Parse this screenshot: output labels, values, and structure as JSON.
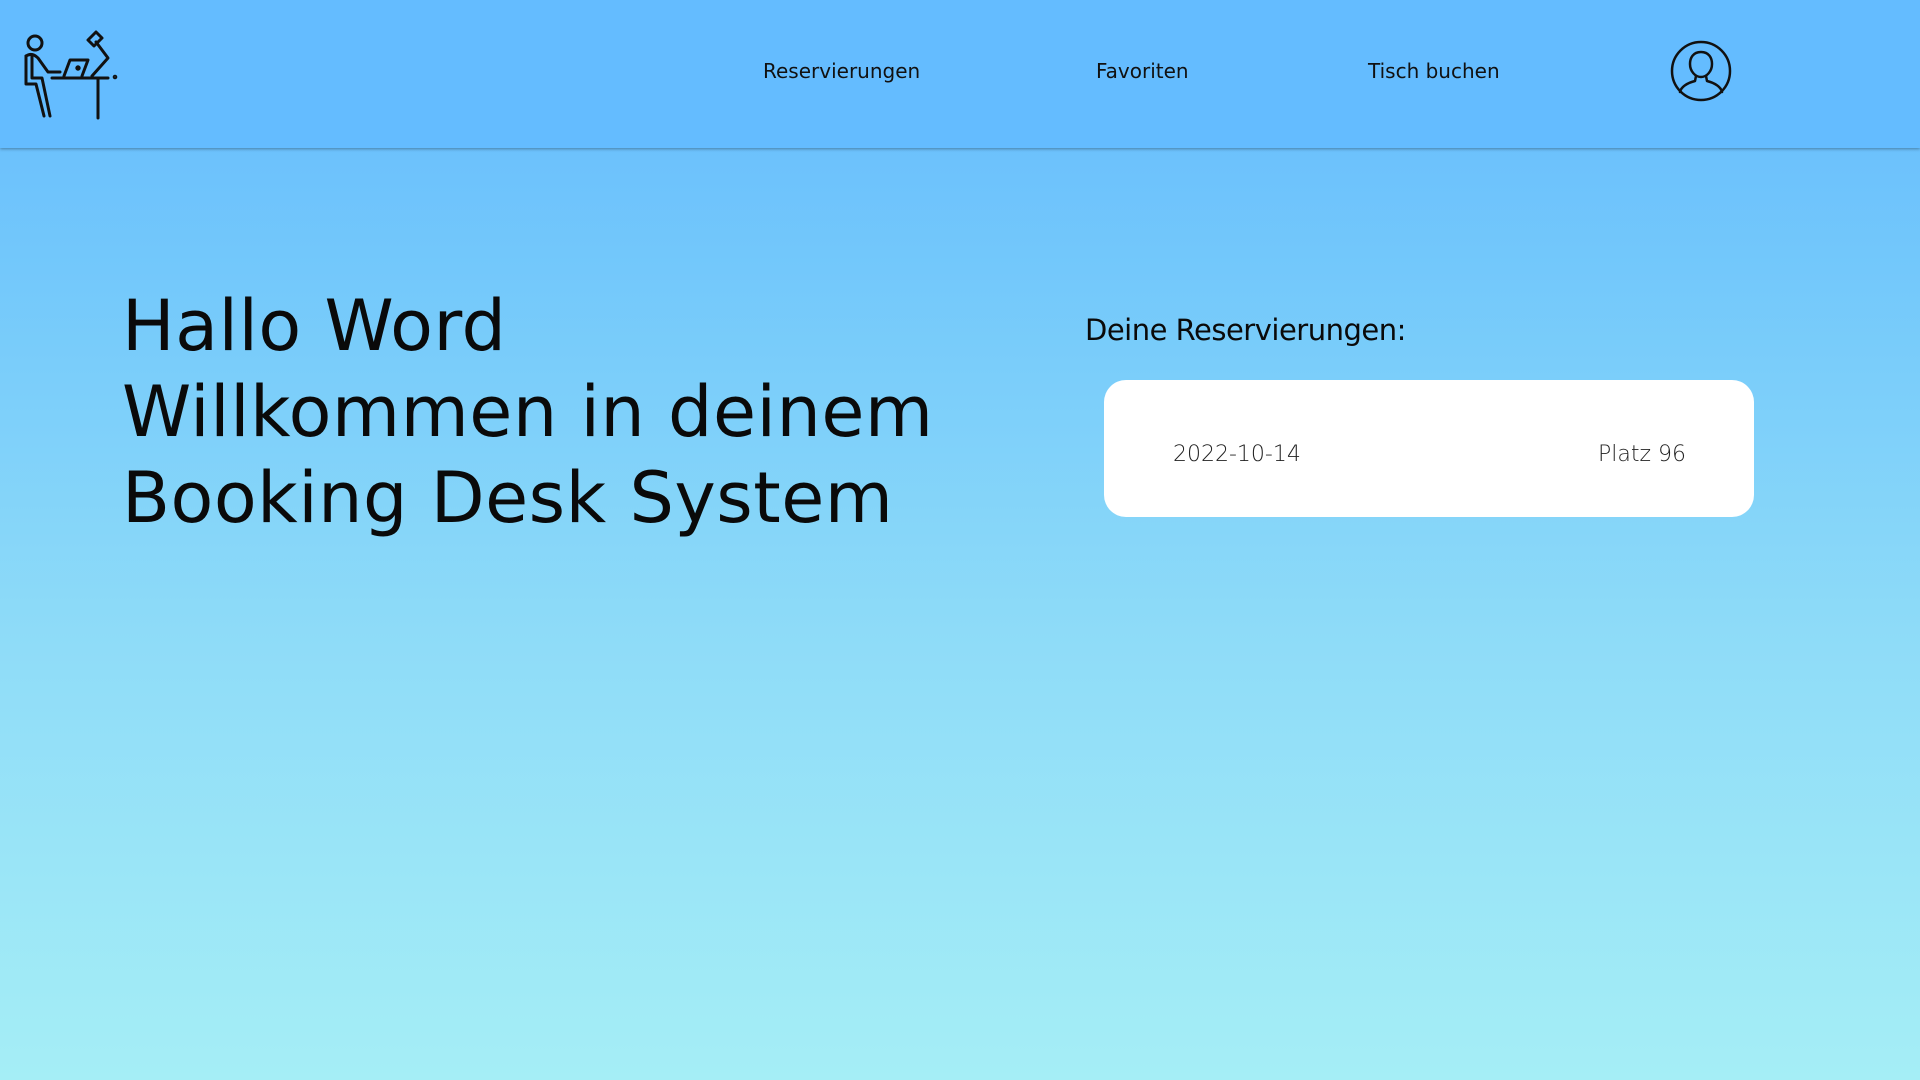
{
  "header": {
    "logo_icon": "desk-worker-icon",
    "nav": [
      {
        "label": "Reservierungen"
      },
      {
        "label": "Favoriten"
      },
      {
        "label": "Tisch buchen"
      }
    ],
    "profile_icon": "user-profile-icon"
  },
  "main": {
    "greeting": {
      "line1": "Hallo Word",
      "line2": "Willkommen in deinem",
      "line3": "Booking Desk System"
    },
    "reservations": {
      "title": "Deine Reservierungen:",
      "items": [
        {
          "date": "2022-10-14",
          "seat": "Platz 96"
        }
      ]
    }
  },
  "colors": {
    "header_bg": "#64bcff",
    "gradient_top": "#64b9fd",
    "gradient_bottom": "#a5eef6",
    "card_bg": "#ffffff"
  }
}
